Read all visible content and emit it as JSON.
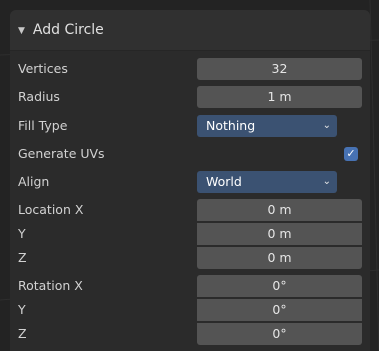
{
  "panel": {
    "title": "Add Circle",
    "caret": "▼"
  },
  "fields": {
    "vertices": {
      "label": "Vertices",
      "value": "32"
    },
    "radius": {
      "label": "Radius",
      "value": "1 m"
    },
    "fill_type": {
      "label": "Fill Type",
      "value": "Nothing",
      "options_visible": [
        "Nothing"
      ]
    },
    "generate_uvs": {
      "label": "Generate UVs",
      "checked": true
    },
    "align": {
      "label": "Align",
      "value": "World"
    },
    "location": {
      "x": {
        "label": "Location X",
        "value": "0 m"
      },
      "y": {
        "label": "Y",
        "value": "0 m"
      },
      "z": {
        "label": "Z",
        "value": "0 m"
      }
    },
    "rotation": {
      "x": {
        "label": "Rotation X",
        "value": "0°"
      },
      "y": {
        "label": "Y",
        "value": "0°"
      },
      "z": {
        "label": "Z",
        "value": "0°"
      }
    }
  },
  "icons": {
    "caret": "caret-down-icon",
    "chevron": "chevron-down-icon",
    "check": "check-icon"
  },
  "colors": {
    "dropdown_bg": "#3b5272",
    "checkbox_bg": "#4772b3",
    "field_bg": "#545454",
    "panel_bg": "#2b2b2b"
  }
}
